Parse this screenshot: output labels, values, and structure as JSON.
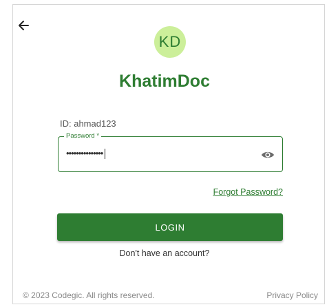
{
  "header": {
    "back_icon": "arrow-left-icon"
  },
  "brand": {
    "avatar_initials": "KD",
    "app_name": "KhatimDoc",
    "accent_color": "#2e7d32",
    "avatar_bg": "#ccef9a"
  },
  "form": {
    "id_text": "ID: ahmad123",
    "password_label": "Password *",
    "password_value": "•••••••••••••••",
    "visibility_icon": "eye-icon",
    "forgot_password": "Forgot Password?",
    "login_button": "LOGIN",
    "signup_link": "Don't have an account?"
  },
  "footer": {
    "copyright": "© 2023 Codegic. All rights reserved.",
    "privacy": "Privacy Policy"
  }
}
